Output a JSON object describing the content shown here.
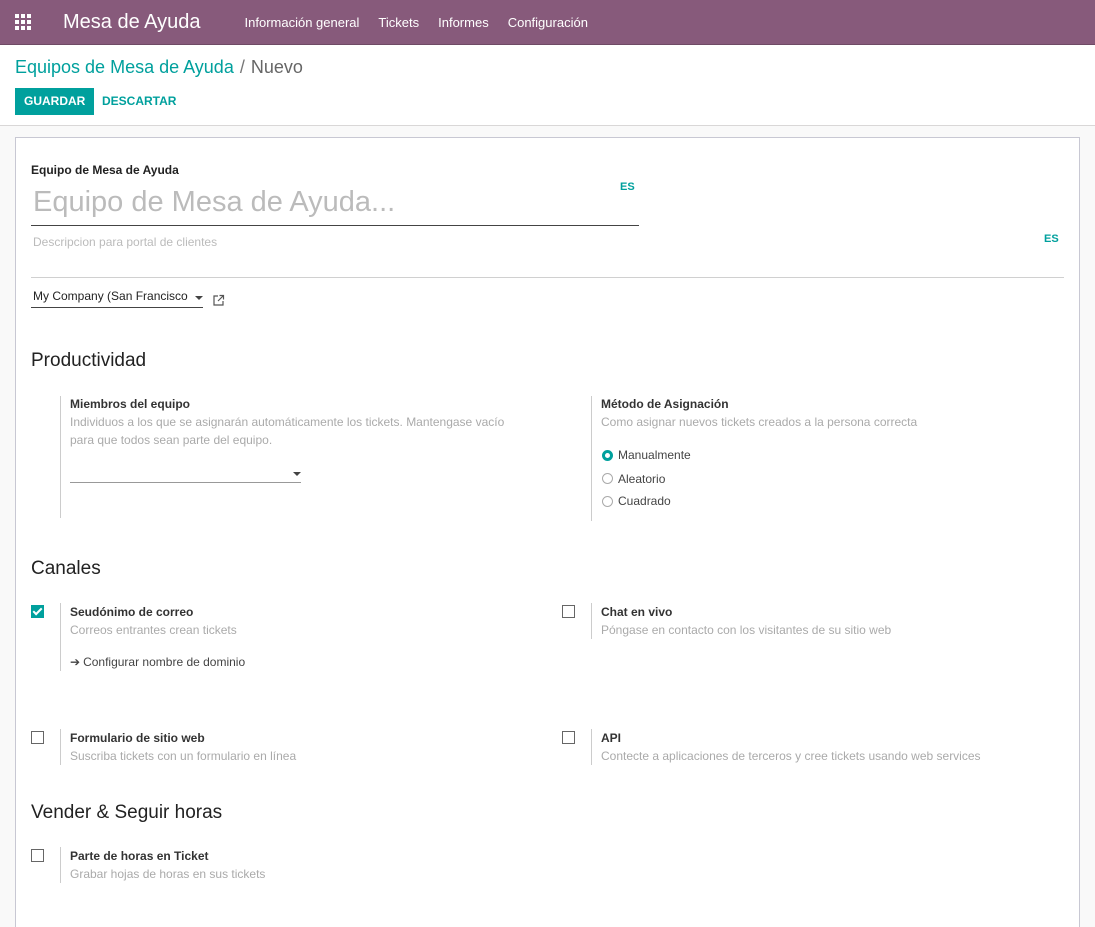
{
  "navbar": {
    "brand": "Mesa de Ayuda",
    "menu": [
      "Información general",
      "Tickets",
      "Informes",
      "Configuración"
    ]
  },
  "breadcrumb": {
    "parent": "Equipos de Mesa de Ayuda",
    "separator": "/",
    "current": "Nuevo"
  },
  "actions": {
    "save": "GUARDAR",
    "discard": "DESCARTAR"
  },
  "form": {
    "name_label": "Equipo de Mesa de Ayuda",
    "name_placeholder": "Equipo de Mesa de Ayuda...",
    "lang_code": "ES",
    "description_placeholder": "Descripcion para portal de clientes",
    "company": "My Company (San Francisco"
  },
  "productivity": {
    "title": "Productividad",
    "members": {
      "title": "Miembros del equipo",
      "help_line1": "Individuos a los que se asignarán automáticamente los tickets. Mantengase vacío",
      "help_line2": "para que todos sean parte del equipo."
    },
    "assignment": {
      "title": "Método de Asignación",
      "help": "Como asignar nuevos tickets creados a la persona correcta",
      "options": [
        {
          "label": "Manualmente",
          "checked": true
        },
        {
          "label": "Aleatorio",
          "checked": false
        },
        {
          "label": "Cuadrado",
          "checked": false
        }
      ]
    }
  },
  "channels": {
    "title": "Canales",
    "email_alias": {
      "title": "Seudónimo de correo",
      "help": "Correos entrantes crean tickets",
      "checked": true,
      "link": "Configurar nombre de dominio"
    },
    "live_chat": {
      "title": "Chat en vivo",
      "help": "Póngase en contacto con los visitantes de su sitio web",
      "checked": false
    },
    "website_form": {
      "title": "Formulario de sitio web",
      "help": "Suscriba tickets con un formulario en línea",
      "checked": false
    },
    "api": {
      "title": "API",
      "help": "Contecte a aplicaciones de terceros y cree tickets usando web services",
      "checked": false
    }
  },
  "sell": {
    "title": "Vender & Seguir horas",
    "timesheet": {
      "title": "Parte de horas en Ticket",
      "help": "Grabar hojas de horas en sus tickets",
      "checked": false
    }
  },
  "colors": {
    "navbar": "#875a7b",
    "accent": "#00a09d"
  }
}
